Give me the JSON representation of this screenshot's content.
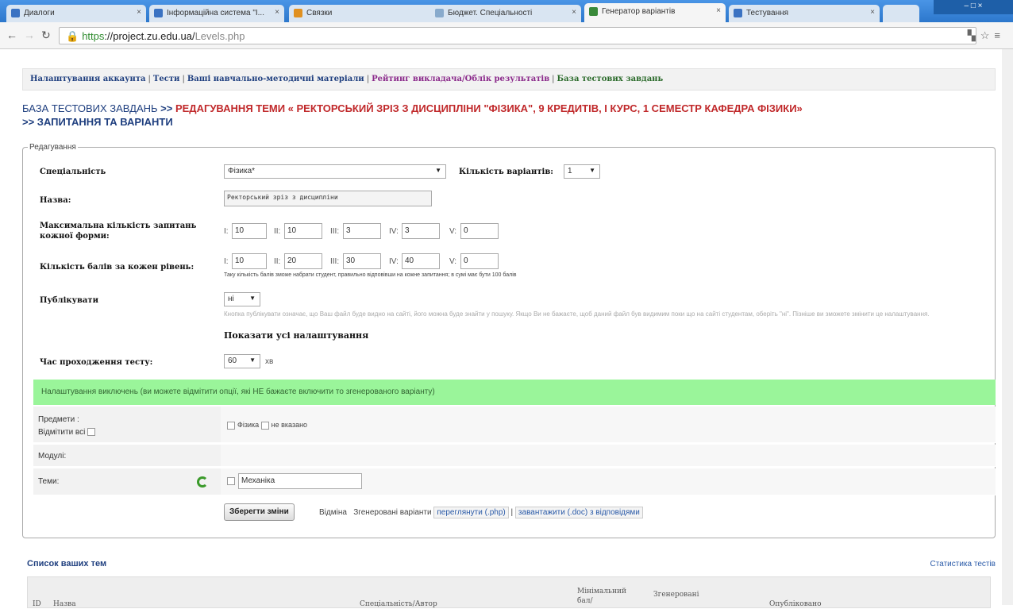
{
  "browser": {
    "tabs": [
      {
        "label": "Диалоги",
        "close": "×"
      },
      {
        "label": "Інформаційна система \"І...",
        "close": "×"
      },
      {
        "label": "Связки",
        "close": "×"
      },
      {
        "label": "Бюджет. Спеціальності",
        "close": "×"
      },
      {
        "label": "Генератор варіантів",
        "close": "×"
      },
      {
        "label": "Тестування",
        "close": "×"
      }
    ],
    "window_controls": "‒ □ ×",
    "url_https": "https",
    "url_host": "://project.zu.edu.ua/",
    "url_path": "Levels.php"
  },
  "menu": {
    "items": [
      "Налаштування аккаунта",
      "Тести",
      "Ваші навчально-методичні матеріали",
      "Рейтинг викладача/Облік результатів",
      "База тестових завдань"
    ]
  },
  "heading": {
    "part1": "БАЗА ТЕСТОВИХ ЗАВДАНЬ",
    "arrow1": " >> ",
    "part2": "РЕДАГУВАННЯ ТЕМИ « РЕКТОРСЬКИЙ ЗРІЗ З ДИСЦИПЛІНИ \"ФІЗИКА\", 9 КРЕДИТІВ, І КУРС, 1 СЕМЕСТР КАФЕДРА ФІЗИКИ»",
    "arrow2": ">> ",
    "part3": "ЗАПИТАННЯ ТА ВАРІАНТИ"
  },
  "form": {
    "legend": "Редагування",
    "specialty_label": "Спеціальність",
    "specialty_value": "Фізика*",
    "variants_label": "Кількість варіантів:",
    "variants_value": "1",
    "name_label": "Назва:",
    "name_value": "Ректорський зріз з дисципліни",
    "max_q_label": "Максимальна кількість запитань кожної форми:",
    "max_q": [
      {
        "level": "І:",
        "value": "10"
      },
      {
        "level": "ІІ:",
        "value": "10"
      },
      {
        "level": "ІІІ:",
        "value": "3"
      },
      {
        "level": "IV:",
        "value": "3"
      },
      {
        "level": "V:",
        "value": "0"
      }
    ],
    "points_label": "Кількість балів за кожен рівень:",
    "points": [
      {
        "level": "І:",
        "value": "10"
      },
      {
        "level": "ІІ:",
        "value": "20"
      },
      {
        "level": "ІІІ:",
        "value": "30"
      },
      {
        "level": "IV:",
        "value": "40"
      },
      {
        "level": "V:",
        "value": "0"
      }
    ],
    "points_hint": "Таку кількість балів зможе набрати студент, правильно відповівши на кожне запитання; в сумі має бути 100 балів",
    "publish_label": "Публікувати",
    "publish_value": "ні",
    "publish_hint": "Кнопка публікувати означає, що Ваш файл буде видно на сайті, його можна буде знайти у пошуку. Якщо Ви не бажаєте, щоб даний файл був видимим поки що на сайті студентам, оберіть \"ні\". Пізніше ви зможете змінити це налаштування.",
    "show_all": "Показати усі налаштування",
    "time_label": "Час проходження тесту:",
    "time_value": "60",
    "time_unit": "хв"
  },
  "green_notice": "Налаштування виключень (ви можете відмітити опції, які НЕ бажаєте включити то згенерованого варіанту)",
  "rows": {
    "subjects_label": "Предмети :",
    "select_all_label": "Відмітити всі",
    "subject1": "Фізика",
    "subject2": "не вказано",
    "modules_label": "Модулі:",
    "themes_label": "Теми:",
    "theme_value": "Механіка"
  },
  "actions": {
    "save": "Зберегти зміни",
    "cancel": "Відміна",
    "generated_label": "Згенеровані варіанти",
    "view_link": "переглянути (.php)",
    "sep": "|",
    "download_link": "завантажити (.doc) з відповідями"
  },
  "list": {
    "title": "Список ваших тем",
    "stats_link": "Статистика тестів",
    "columns": [
      "ID",
      "Назва",
      "Спеціальність/Автор",
      "Мінімальний бал/",
      "Згенеровані",
      "Опубліковано"
    ]
  }
}
